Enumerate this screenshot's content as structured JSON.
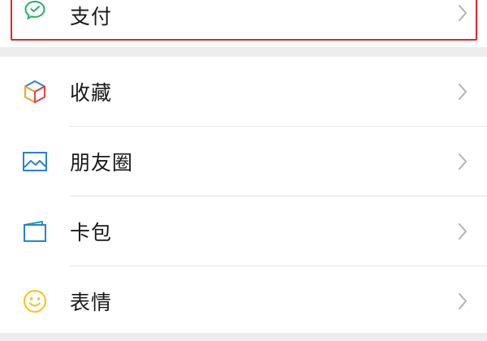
{
  "pay": {
    "label": "支付",
    "icon": "wechat-pay-icon"
  },
  "menu": {
    "items": [
      {
        "label": "收藏",
        "icon": "cube-icon"
      },
      {
        "label": "朋友圈",
        "icon": "picture-icon"
      },
      {
        "label": "卡包",
        "icon": "wallet-card-icon"
      },
      {
        "label": "表情",
        "icon": "smiley-icon"
      }
    ]
  },
  "colors": {
    "highlight": "#e0262a",
    "pay_green": "#2aae67",
    "picture_blue": "#2782d7",
    "wallet_teal": "#19a5a5",
    "smiley_yellow": "#f7c21a"
  }
}
